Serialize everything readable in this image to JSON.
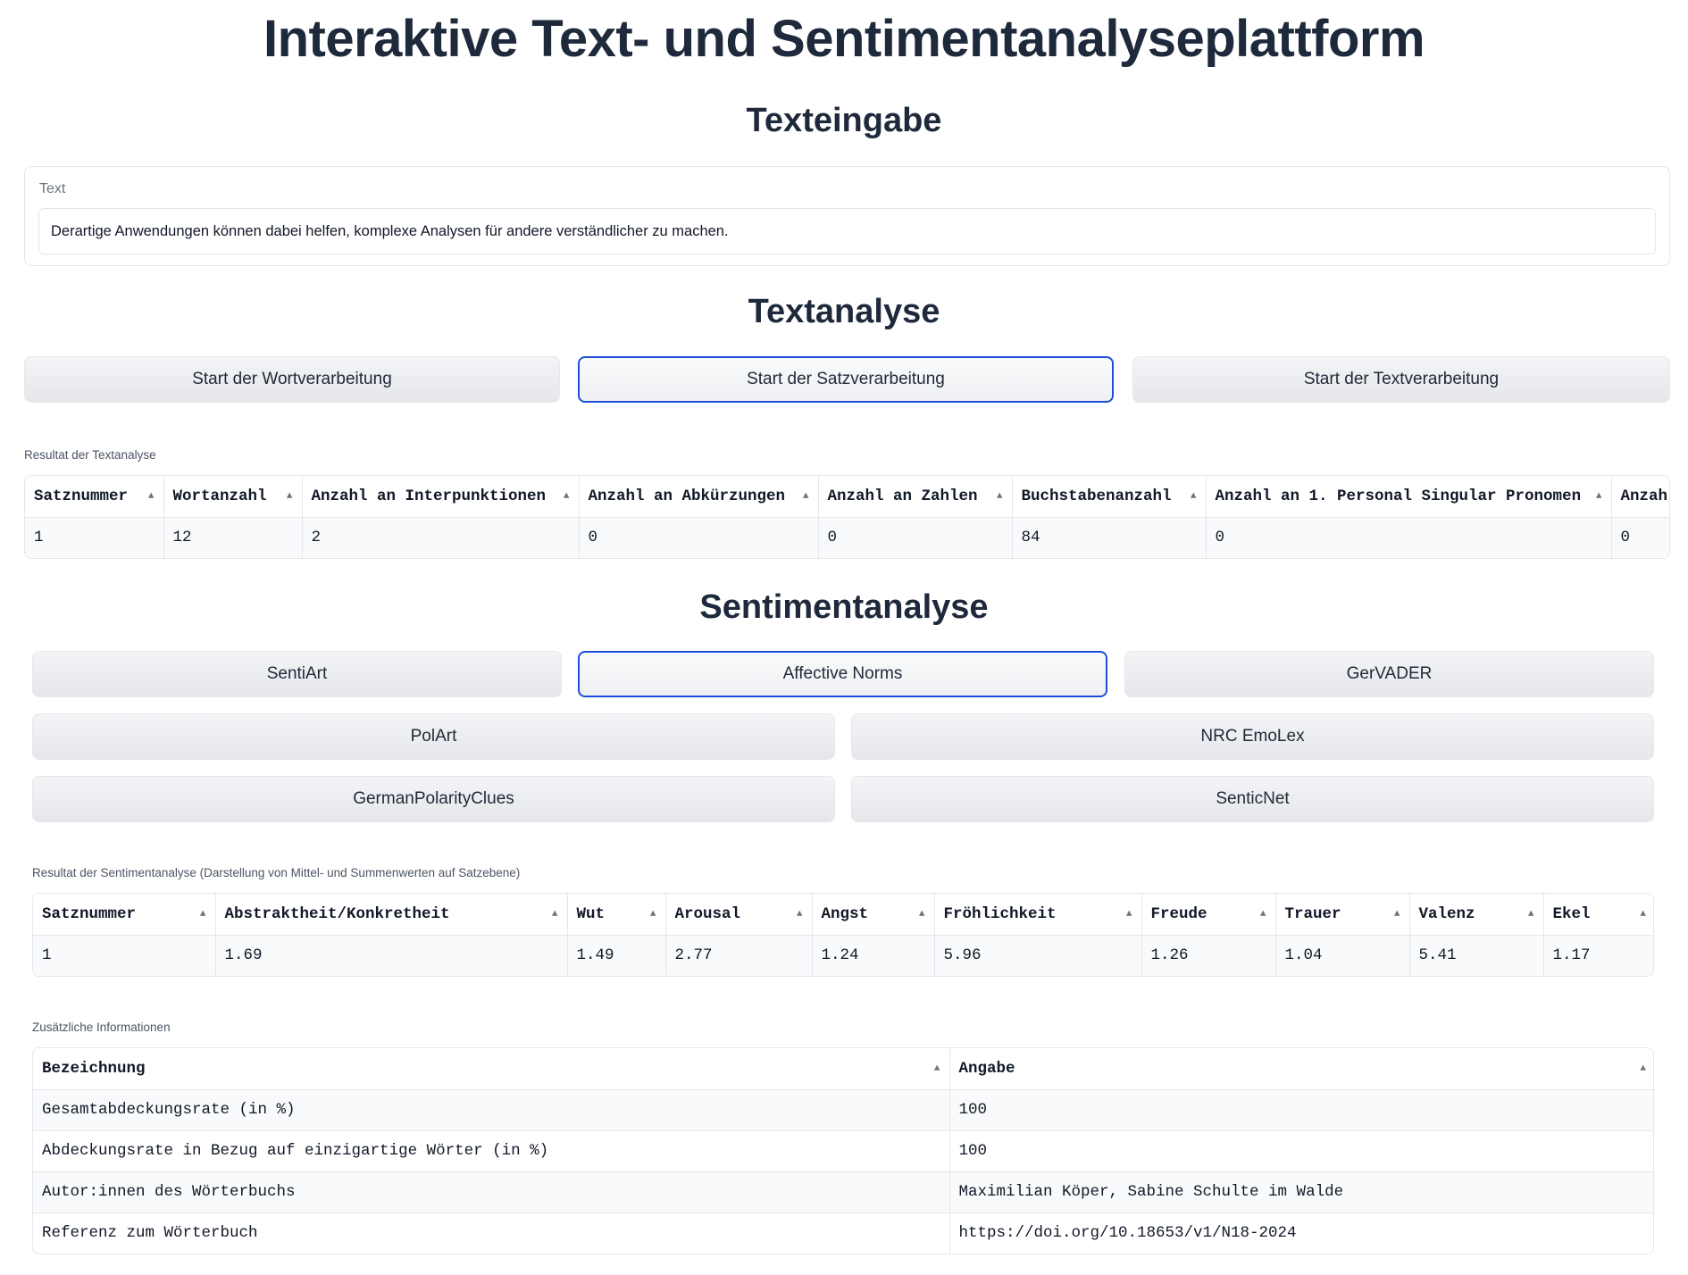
{
  "page": {
    "title": "Interaktive Text- und Sentimentanalyseplattform"
  },
  "text_input_section": {
    "heading": "Texteingabe",
    "label": "Text",
    "value": "Derartige Anwendungen können dabei helfen, komplexe Analysen für andere verständlicher zu machen."
  },
  "text_analysis": {
    "heading": "Textanalyse",
    "buttons": [
      "Start der Wortverarbeitung",
      "Start der Satzverarbeitung",
      "Start der Textverarbeitung"
    ],
    "active_button": "Start der Satzverarbeitung",
    "result_caption": "Resultat der Textanalyse",
    "columns": [
      "Satznummer",
      "Wortanzahl",
      "Anzahl an Interpunktionen",
      "Anzahl an Abkürzungen",
      "Anzahl an Zahlen",
      "Buchstabenanzahl",
      "Anzahl an 1. Personal Singular Pronomen",
      "Anzah"
    ],
    "rows": [
      [
        "1",
        "12",
        "2",
        "0",
        "0",
        "84",
        "0",
        "0"
      ]
    ]
  },
  "sentiment_analysis": {
    "heading": "Sentimentanalyse",
    "buttons": [
      "SentiArt",
      "Affective Norms",
      "GerVADER",
      "PolArt",
      "NRC EmoLex",
      "GermanPolarityClues",
      "SenticNet"
    ],
    "active_button": "Affective Norms",
    "result_caption": "Resultat der Sentimentanalyse (Darstellung von Mittel- und Summenwerten auf Satzebene)",
    "columns": [
      "Satznummer",
      "Abstraktheit/Konkretheit",
      "Wut",
      "Arousal",
      "Angst",
      "Fröhlichkeit",
      "Freude",
      "Trauer",
      "Valenz",
      "Ekel"
    ],
    "rows": [
      [
        "1",
        "1.69",
        "1.49",
        "2.77",
        "1.24",
        "5.96",
        "1.26",
        "1.04",
        "5.41",
        "1.17"
      ]
    ]
  },
  "additional_info": {
    "caption": "Zusätzliche Informationen",
    "columns": [
      "Bezeichnung",
      "Angabe"
    ],
    "rows": [
      [
        "Gesamtabdeckungsrate (in %)",
        "100"
      ],
      [
        "Abdeckungsrate in Bezug auf einzigartige Wörter (in %)",
        "100"
      ],
      [
        "Autor:innen des Wörterbuchs",
        "Maximilian Köper, Sabine Schulte im Walde"
      ],
      [
        "Referenz zum Wörterbuch",
        "https://doi.org/10.18653/v1/N18-2024"
      ]
    ]
  },
  "icons": {
    "sort": "sort-ascending-icon"
  },
  "colors": {
    "accent": "#1d4ed8",
    "heading": "#1e293b"
  }
}
